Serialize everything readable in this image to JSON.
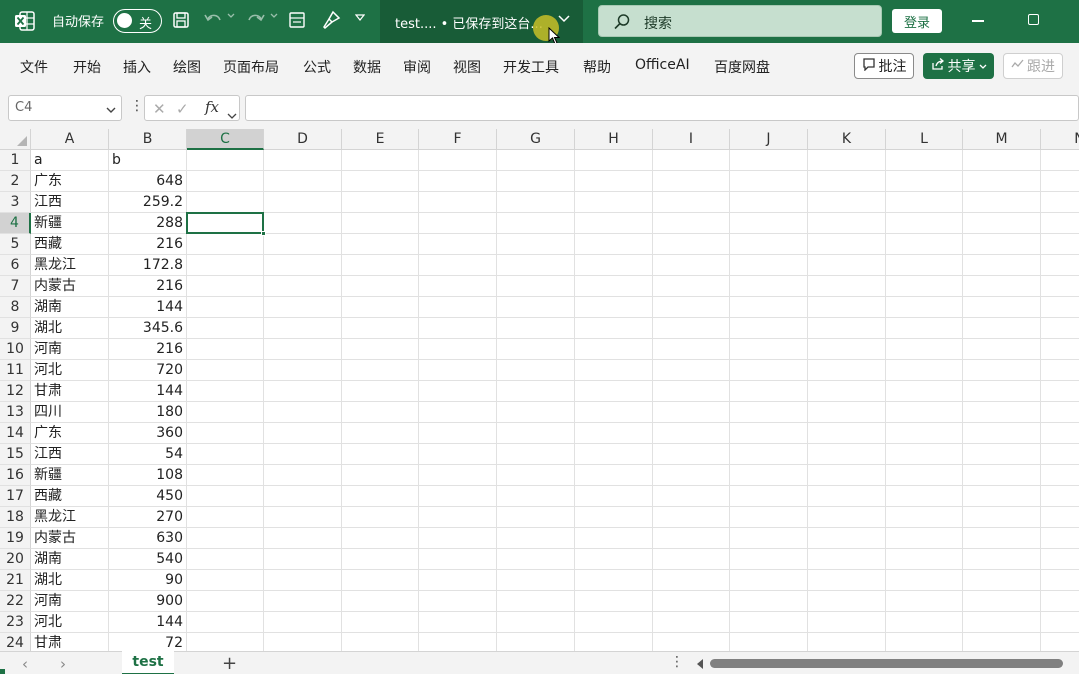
{
  "titlebar": {
    "autosave_label": "自动保存",
    "autosave_state": "关",
    "doc_title": "test....  • 已保存到这台...",
    "search_placeholder": "搜索",
    "login_label": "登录"
  },
  "ribbon": {
    "tabs": [
      "文件",
      "开始",
      "插入",
      "绘图",
      "页面布局",
      "公式",
      "数据",
      "审阅",
      "视图",
      "开发工具",
      "帮助",
      "OfficeAI",
      "百度网盘"
    ],
    "comment_label": "批注",
    "share_label": "共享",
    "follow_label": "跟进"
  },
  "formula_bar": {
    "name_box": "C4",
    "formula": ""
  },
  "grid": {
    "columns": [
      "A",
      "B",
      "C",
      "D",
      "E",
      "F",
      "G",
      "H",
      "I",
      "J",
      "K",
      "L",
      "M",
      "N"
    ],
    "selected_cell": "C4",
    "rows": [
      {
        "num": "1",
        "a": "a",
        "b": "b"
      },
      {
        "num": "2",
        "a": "广东",
        "b": "648"
      },
      {
        "num": "3",
        "a": "江西",
        "b": "259.2"
      },
      {
        "num": "4",
        "a": "新疆",
        "b": "288"
      },
      {
        "num": "5",
        "a": "西藏",
        "b": "216"
      },
      {
        "num": "6",
        "a": "黑龙江",
        "b": "172.8"
      },
      {
        "num": "7",
        "a": "内蒙古",
        "b": "216"
      },
      {
        "num": "8",
        "a": "湖南",
        "b": "144"
      },
      {
        "num": "9",
        "a": "湖北",
        "b": "345.6"
      },
      {
        "num": "10",
        "a": "河南",
        "b": "216"
      },
      {
        "num": "11",
        "a": "河北",
        "b": "720"
      },
      {
        "num": "12",
        "a": "甘肃",
        "b": "144"
      },
      {
        "num": "13",
        "a": "四川",
        "b": "180"
      },
      {
        "num": "14",
        "a": "广东",
        "b": "360"
      },
      {
        "num": "15",
        "a": "江西",
        "b": "54"
      },
      {
        "num": "16",
        "a": "新疆",
        "b": "108"
      },
      {
        "num": "17",
        "a": "西藏",
        "b": "450"
      },
      {
        "num": "18",
        "a": "黑龙江",
        "b": "270"
      },
      {
        "num": "19",
        "a": "内蒙古",
        "b": "630"
      },
      {
        "num": "20",
        "a": "湖南",
        "b": "540"
      },
      {
        "num": "21",
        "a": "湖北",
        "b": "90"
      },
      {
        "num": "22",
        "a": "河南",
        "b": "900"
      },
      {
        "num": "23",
        "a": "河北",
        "b": "144"
      },
      {
        "num": "24",
        "a": "甘肃",
        "b": "72"
      }
    ]
  },
  "sheets": {
    "active": "test",
    "add_label": "+"
  },
  "colors": {
    "brand": "#1e7145",
    "brand_dark": "#185c37",
    "search_bg": "#c6dfcf",
    "chrome_bg": "#f3f3f3",
    "gridline": "#e1e1e1"
  },
  "icons": {
    "app": "excel-logo-icon",
    "save": "save-icon",
    "undo": "undo-icon",
    "redo": "redo-icon",
    "form": "form-icon",
    "format_painter": "brush-icon",
    "search": "search-icon",
    "comment": "comment-icon",
    "share": "share-icon",
    "follow": "follow-icon"
  }
}
